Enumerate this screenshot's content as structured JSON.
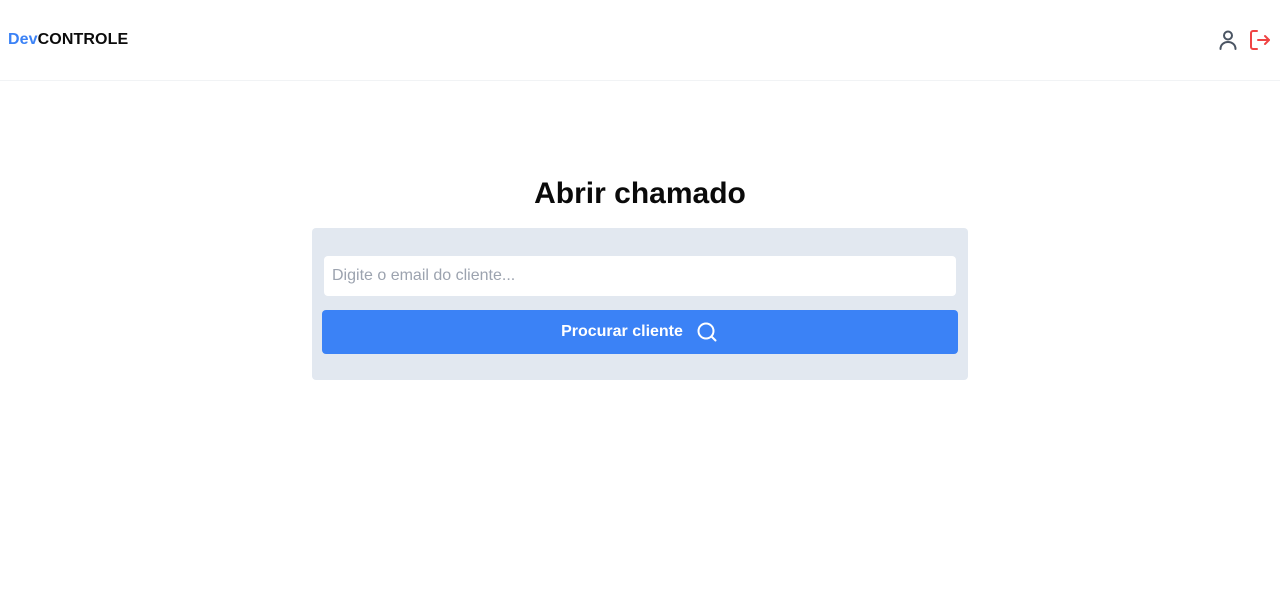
{
  "header": {
    "logo_prefix": "Dev",
    "logo_suffix": "CONTROLE",
    "icons": {
      "profile": "user-icon",
      "logout": "logout-icon"
    }
  },
  "main": {
    "title": "Abrir chamado",
    "search": {
      "placeholder": "Digite o email do cliente...",
      "value": ""
    },
    "button": {
      "label": "Procurar cliente",
      "icon": "search-icon"
    }
  },
  "colors": {
    "accent": "#3b82f6",
    "logout": "#ef4444",
    "panel_bg": "#e2e8f0",
    "text": "#0a0a0a"
  }
}
